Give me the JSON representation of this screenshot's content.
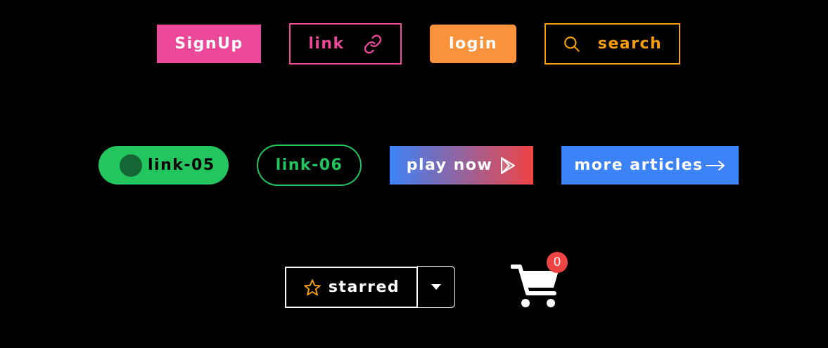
{
  "row1": {
    "signup": "SignUp",
    "link": "link",
    "login": "login",
    "search": "search"
  },
  "row2": {
    "link05": "link-05",
    "link06": "link-06",
    "play_now": "play now",
    "more_articles": "more articles"
  },
  "row3": {
    "starred": "starred",
    "cart_count": "0"
  },
  "icons": {
    "link": "chain-link-icon",
    "search": "magnifier-icon",
    "play": "play-store-icon",
    "more": "arrow-right-icon",
    "starred": "star-outline-icon",
    "dropdown": "caret-down-icon",
    "cart": "shopping-cart-icon"
  },
  "colors": {
    "background": "#000000",
    "pink": "#ec4899",
    "orange": "#fb923c",
    "amber": "#f59e0b",
    "green": "#22c55e",
    "dark_green": "#166534",
    "blue": "#3b82f6",
    "red": "#ef4444",
    "white": "#ffffff"
  }
}
